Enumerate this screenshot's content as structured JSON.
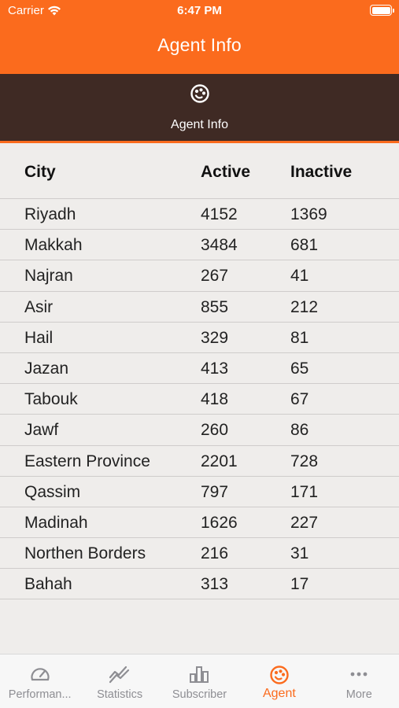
{
  "status": {
    "carrier": "Carrier",
    "time": "6:47 PM"
  },
  "nav": {
    "title": "Agent Info"
  },
  "segment": {
    "label": "Agent Info",
    "icon": "palette-icon"
  },
  "table": {
    "headers": [
      "City",
      "Active",
      "Inactive"
    ],
    "rows": [
      [
        "Riyadh",
        "4152",
        "1369"
      ],
      [
        "Makkah",
        "3484",
        "681"
      ],
      [
        "Najran",
        "267",
        "41"
      ],
      [
        "Asir",
        "855",
        "212"
      ],
      [
        "Hail",
        "329",
        "81"
      ],
      [
        "Jazan",
        "413",
        "65"
      ],
      [
        "Tabouk",
        "418",
        "67"
      ],
      [
        "Jawf",
        "260",
        "86"
      ],
      [
        "Eastern Province",
        "2201",
        "728"
      ],
      [
        "Qassim",
        "797",
        "171"
      ],
      [
        "Madinah",
        "1626",
        "227"
      ],
      [
        "Northen Borders",
        "216",
        "31"
      ],
      [
        "Bahah",
        "313",
        "17"
      ]
    ]
  },
  "tabbar": {
    "items": [
      {
        "label": "Performan...",
        "icon": "speedometer-icon",
        "active": false
      },
      {
        "label": "Statistics",
        "icon": "trend-chart-icon",
        "active": false
      },
      {
        "label": "Subscriber",
        "icon": "bar-chart-icon",
        "active": false
      },
      {
        "label": "Agent",
        "icon": "palette-icon",
        "active": true
      },
      {
        "label": "More",
        "icon": "more-dots-icon",
        "active": false
      }
    ]
  },
  "colors": {
    "accent": "#fb6b1d",
    "header_dark": "#3f2a24",
    "background": "#efedeb",
    "inactive_tab": "#8e8e93"
  }
}
